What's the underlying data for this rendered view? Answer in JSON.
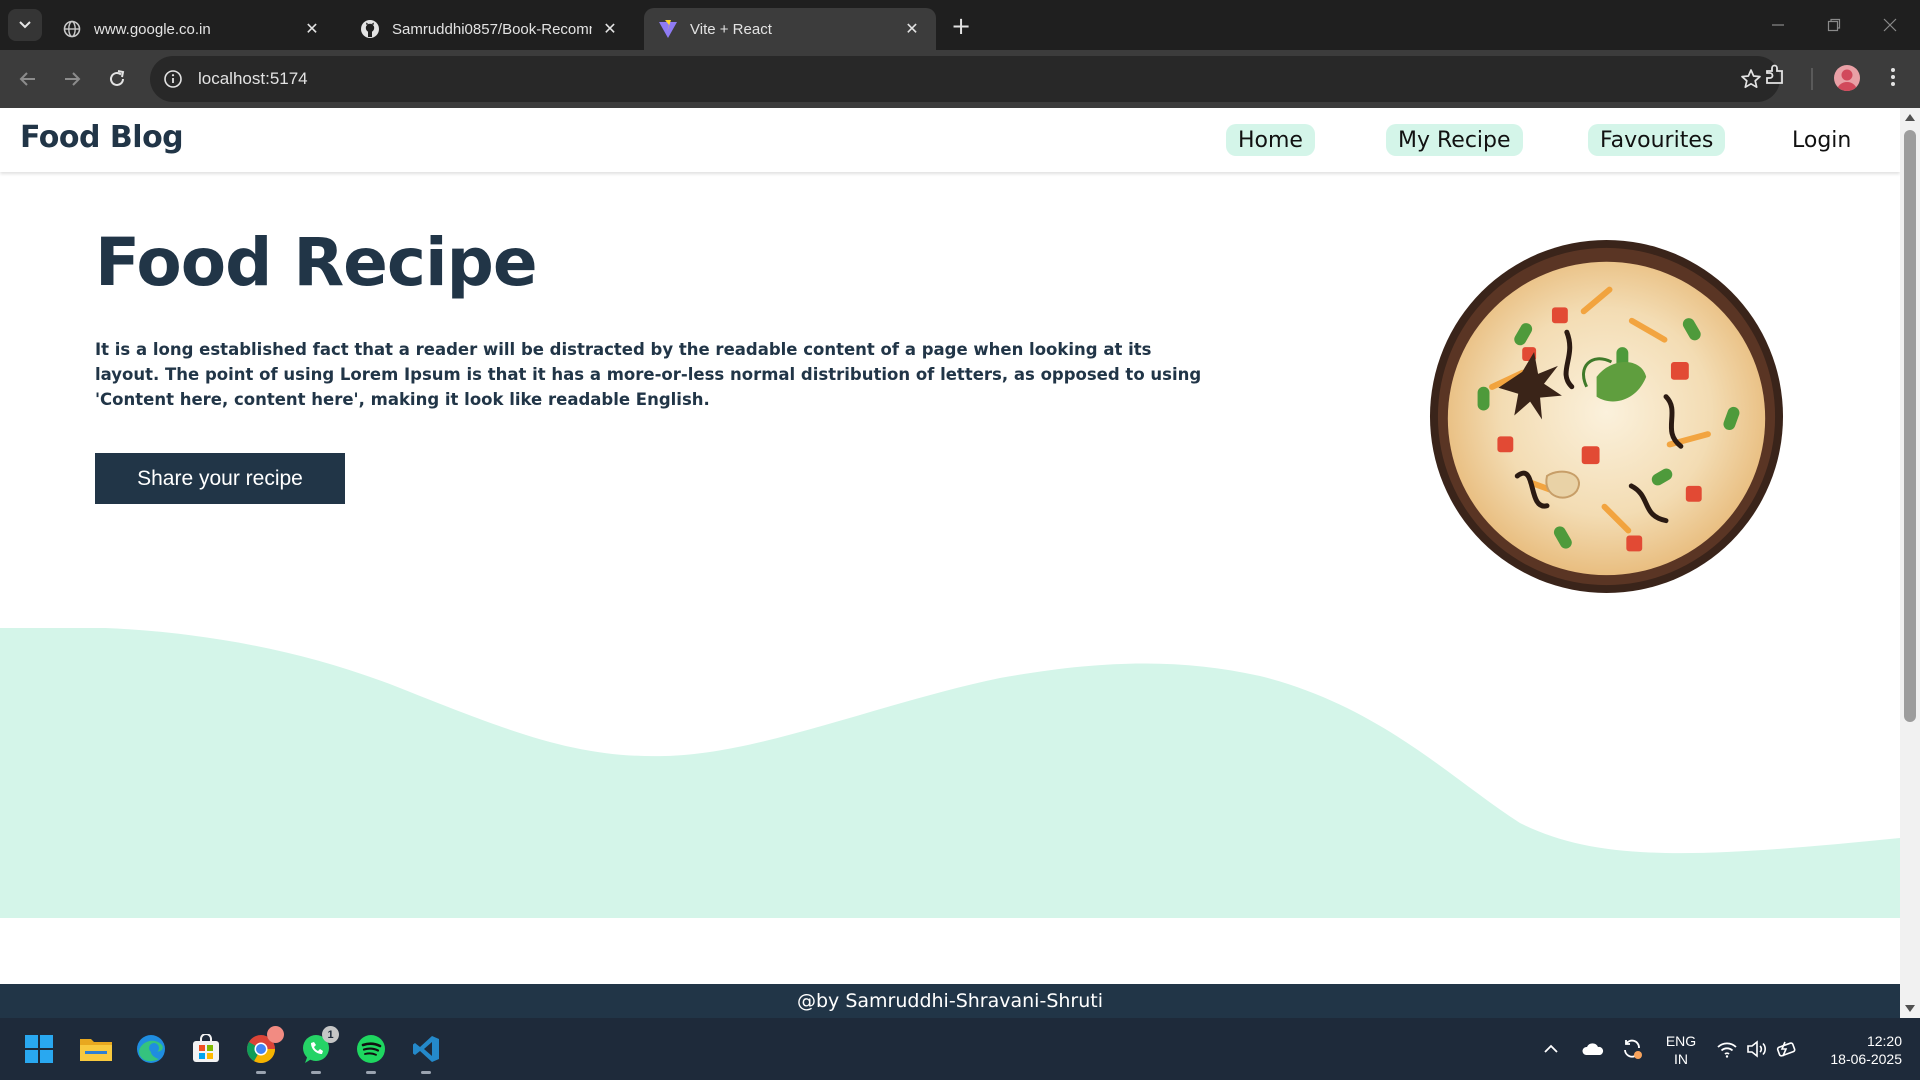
{
  "browser": {
    "tabs": [
      {
        "title": "www.google.co.in",
        "icon": "globe-icon",
        "active": false
      },
      {
        "title": "Samruddhi0857/Book-Recomm",
        "icon": "github-icon",
        "active": false
      },
      {
        "title": "Vite + React",
        "icon": "vite-icon",
        "active": true
      }
    ],
    "url": "localhost:5174"
  },
  "site": {
    "brand": "Food Blog",
    "nav": [
      "Home",
      "My Recipe",
      "Favourites",
      "Login"
    ],
    "hero": {
      "title": "Food Recipe",
      "text": "It is a long established fact that a reader will be distracted by the readable content of a page when looking at its layout. The point of using Lorem Ipsum is that it has a more-or-less normal distribution of letters, as opposed to using 'Content here, content here', making it look like readable English.",
      "button": "Share your recipe"
    },
    "footer": "@by Samruddhi-Shravani-Shruti",
    "colors": {
      "primary": "#213547",
      "accent": "#d4f5e9",
      "wave": "#d4f5e9"
    }
  },
  "taskbar": {
    "apps": [
      "windows-start-icon",
      "file-explorer-icon",
      "edge-icon",
      "microsoft-store-icon",
      "chrome-icon",
      "whatsapp-icon",
      "spotify-icon",
      "vscode-icon"
    ],
    "whatsapp_badge": "1",
    "language": [
      "ENG",
      "IN"
    ],
    "time": "12:20",
    "date": "18-06-2025"
  }
}
